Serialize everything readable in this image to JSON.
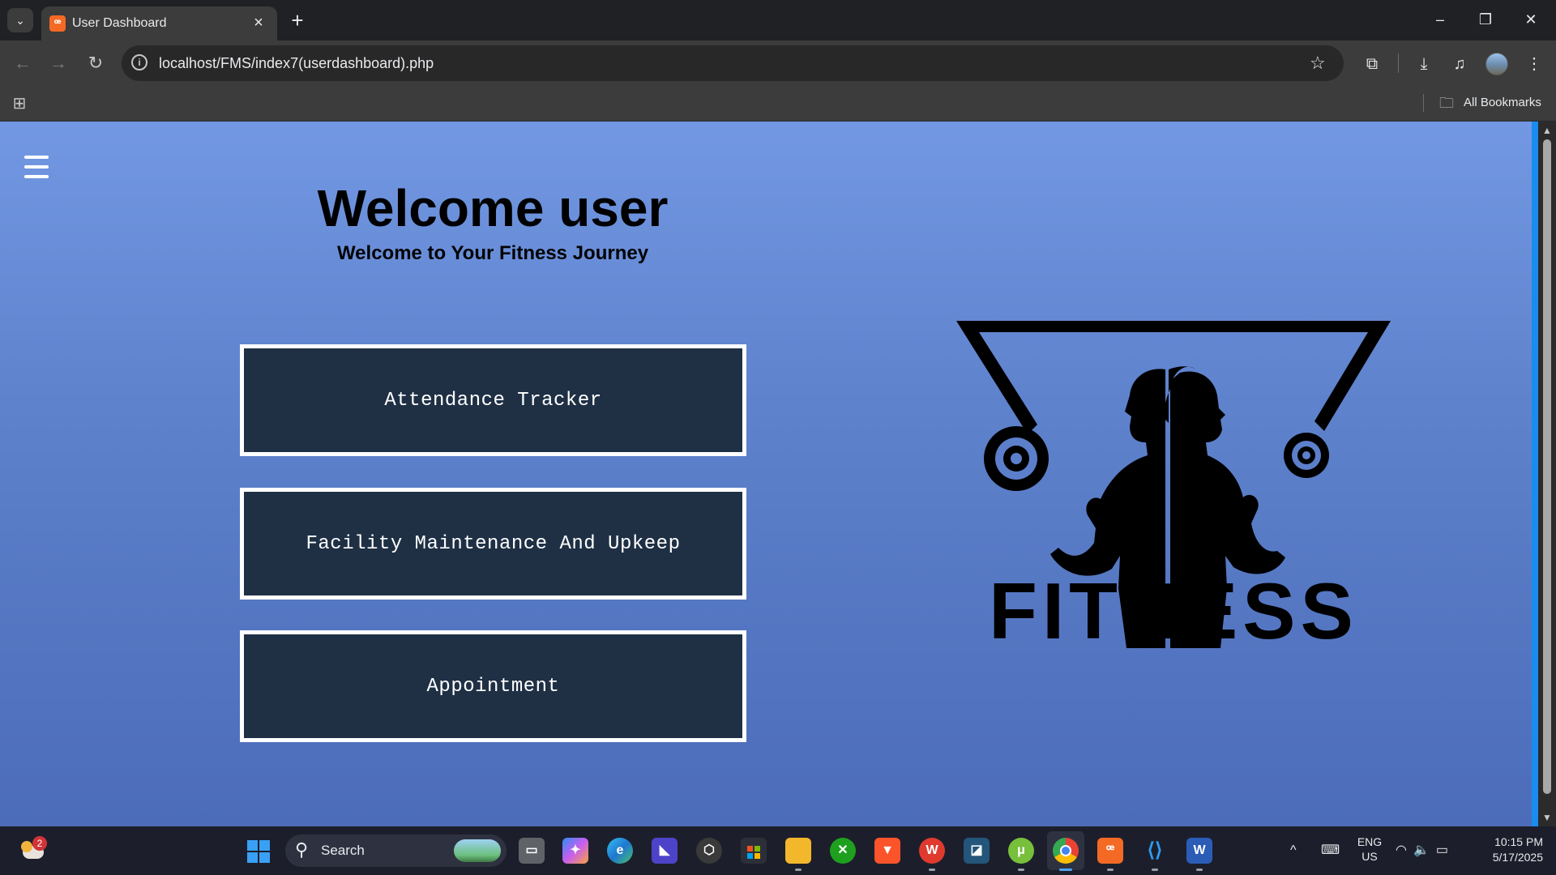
{
  "browser": {
    "tab_title": "User Dashboard",
    "tab_favicon_glyph": "ꟹ",
    "url": "localhost/FMS/index7(userdashboard).php",
    "bookmarks_label": "All Bookmarks",
    "icons": [
      "tab-search-icon",
      "close-icon",
      "plus-icon",
      "minimize-icon",
      "restore-icon",
      "close-window-icon",
      "back-icon",
      "forward-icon",
      "reload-icon",
      "site-info-icon",
      "star-icon",
      "extensions-icon",
      "download-icon",
      "media-icon",
      "profile-avatar",
      "more-menu-icon",
      "apps-grid-icon",
      "folder-icon"
    ]
  },
  "page": {
    "title": "Welcome user",
    "subtitle": "Welcome to Your Fitness Journey",
    "buttons": [
      {
        "label": "Attendance Tracker"
      },
      {
        "label": "Facility Maintenance And Upkeep"
      },
      {
        "label": "Appointment"
      }
    ],
    "logo": {
      "text": "FITNESS"
    },
    "colors": {
      "background_top": "#7398e3",
      "background_bottom": "#4c6cb9",
      "button_bg": "#1f3045",
      "button_border": "#ffffff"
    }
  },
  "taskbar": {
    "weather_badge": "2",
    "search_label": "Search",
    "language": {
      "line1": "ENG",
      "line2": "US"
    },
    "time": "10:15 PM",
    "date": "5/17/2025",
    "apps": [
      "task-view",
      "copilot",
      "edge",
      "visual-studio",
      "obs",
      "microsoft-store",
      "file-explorer",
      "xbox",
      "brave",
      "wps-office",
      "mysql-workbench",
      "utorrent",
      "chrome",
      "xampp",
      "vs-code",
      "word"
    ]
  }
}
